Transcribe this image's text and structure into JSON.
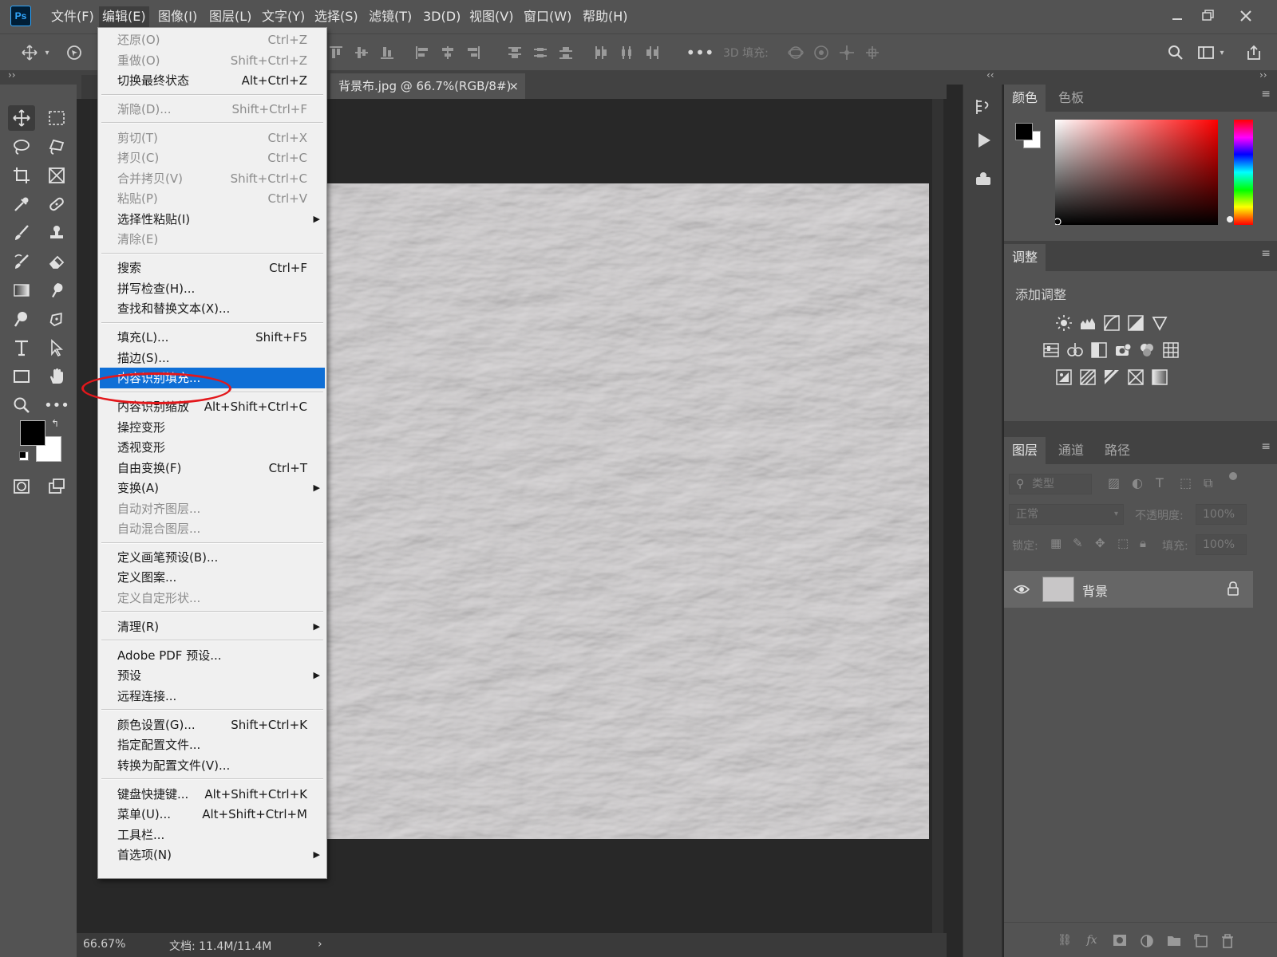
{
  "app": {
    "logo": "Ps"
  },
  "menubar": {
    "items": [
      "文件(F)",
      "编辑(E)",
      "图像(I)",
      "图层(L)",
      "文字(Y)",
      "选择(S)",
      "滤镜(T)",
      "3D(D)",
      "视图(V)",
      "窗口(W)",
      "帮助(H)"
    ],
    "active_index": 1,
    "window_controls": [
      "minimize-icon",
      "restore-icon",
      "close-icon"
    ]
  },
  "options_bar": {
    "fill_label": "3D 填充:",
    "icons": [
      "move-tool-icon",
      "chevron-down-icon",
      "auto-select-icon",
      "align-top-icon",
      "align-vcenter-icon",
      "align-bottom-icon",
      "align-left-icon",
      "align-hcenter-icon",
      "align-right-icon",
      "distribute-top-icon",
      "distribute-vcenter-icon",
      "distribute-bottom-icon",
      "distribute-left-icon",
      "distribute-hcenter-icon",
      "distribute-right-icon",
      "more-icon",
      "3d-orbit-icon",
      "3d-roll-icon",
      "3d-pan-icon",
      "3d-slide-icon",
      "search-icon",
      "workspace-icon",
      "share-icon"
    ]
  },
  "document": {
    "tab_title": "背景布.jpg @ 66.7%(RGB/8#)",
    "tab_close": "×",
    "zoom": "66.67%",
    "doc_info": "文档: 11.4M/11.4M",
    "status_arrow": "›"
  },
  "colors": {
    "foreground": "#000000",
    "background": "#ffffff",
    "highlight": "#0f6fd6",
    "annotation_oval": "#e3171b",
    "panel_bg": "#535353"
  },
  "edit_menu": {
    "items": [
      {
        "label": "还原(O)",
        "shortcut": "Ctrl+Z",
        "disabled": true
      },
      {
        "label": "重做(O)",
        "shortcut": "Shift+Ctrl+Z",
        "disabled": true
      },
      {
        "label": "切换最终状态",
        "shortcut": "Alt+Ctrl+Z",
        "disabled": false
      },
      {
        "sep": true
      },
      {
        "label": "渐隐(D)...",
        "shortcut": "Shift+Ctrl+F",
        "disabled": true
      },
      {
        "sep": true
      },
      {
        "label": "剪切(T)",
        "shortcut": "Ctrl+X",
        "disabled": true
      },
      {
        "label": "拷贝(C)",
        "shortcut": "Ctrl+C",
        "disabled": true
      },
      {
        "label": "合并拷贝(V)",
        "shortcut": "Shift+Ctrl+C",
        "disabled": true
      },
      {
        "label": "粘贴(P)",
        "shortcut": "Ctrl+V",
        "disabled": true
      },
      {
        "label": "选择性粘贴(I)",
        "shortcut": "",
        "disabled": false,
        "submenu": true
      },
      {
        "label": "清除(E)",
        "shortcut": "",
        "disabled": true
      },
      {
        "sep": true
      },
      {
        "label": "搜索",
        "shortcut": "Ctrl+F",
        "disabled": false
      },
      {
        "label": "拼写检查(H)...",
        "shortcut": "",
        "disabled": false
      },
      {
        "label": "查找和替换文本(X)...",
        "shortcut": "",
        "disabled": false
      },
      {
        "sep": true
      },
      {
        "label": "填充(L)...",
        "shortcut": "Shift+F5",
        "disabled": false
      },
      {
        "label": "描边(S)...",
        "shortcut": "",
        "disabled": false
      },
      {
        "label": "内容识别填充...",
        "shortcut": "",
        "disabled": false,
        "highlighted": true
      },
      {
        "sep": true
      },
      {
        "label": "内容识别缩放",
        "shortcut": "Alt+Shift+Ctrl+C",
        "disabled": false
      },
      {
        "label": "操控变形",
        "shortcut": "",
        "disabled": false
      },
      {
        "label": "透视变形",
        "shortcut": "",
        "disabled": false
      },
      {
        "label": "自由变换(F)",
        "shortcut": "Ctrl+T",
        "disabled": false
      },
      {
        "label": "变换(A)",
        "shortcut": "",
        "disabled": false,
        "submenu": true
      },
      {
        "label": "自动对齐图层...",
        "shortcut": "",
        "disabled": true
      },
      {
        "label": "自动混合图层...",
        "shortcut": "",
        "disabled": true
      },
      {
        "sep": true
      },
      {
        "label": "定义画笔预设(B)...",
        "shortcut": "",
        "disabled": false
      },
      {
        "label": "定义图案...",
        "shortcut": "",
        "disabled": false
      },
      {
        "label": "定义自定形状...",
        "shortcut": "",
        "disabled": true
      },
      {
        "sep": true
      },
      {
        "label": "清理(R)",
        "shortcut": "",
        "disabled": false,
        "submenu": true
      },
      {
        "sep": true
      },
      {
        "label": "Adobe PDF 预设...",
        "shortcut": "",
        "disabled": false
      },
      {
        "label": "预设",
        "shortcut": "",
        "disabled": false,
        "submenu": true
      },
      {
        "label": "远程连接...",
        "shortcut": "",
        "disabled": false
      },
      {
        "sep": true
      },
      {
        "label": "颜色设置(G)...",
        "shortcut": "Shift+Ctrl+K",
        "disabled": false
      },
      {
        "label": "指定配置文件...",
        "shortcut": "",
        "disabled": false
      },
      {
        "label": "转换为配置文件(V)...",
        "shortcut": "",
        "disabled": false
      },
      {
        "sep": true
      },
      {
        "label": "键盘快捷键...",
        "shortcut": "Alt+Shift+Ctrl+K",
        "disabled": false
      },
      {
        "label": "菜单(U)...",
        "shortcut": "Alt+Shift+Ctrl+M",
        "disabled": false
      },
      {
        "label": "工具栏...",
        "shortcut": "",
        "disabled": false
      },
      {
        "label": "首选项(N)",
        "shortcut": "",
        "disabled": false,
        "submenu": true
      }
    ]
  },
  "color_panel": {
    "tabs": [
      "颜色",
      "色板"
    ],
    "active_tab": 0
  },
  "adjustments_panel": {
    "tab": "调整",
    "title": "添加调整",
    "icons": [
      "brightness-contrast-icon",
      "levels-icon",
      "curves-icon",
      "exposure-icon",
      "vibrance-icon",
      "hue-saturation-icon",
      "color-balance-icon",
      "black-white-icon",
      "photo-filter-icon",
      "channel-mixer-icon",
      "color-lookup-icon",
      "invert-icon",
      "posterize-icon",
      "threshold-icon",
      "selective-color-icon",
      "gradient-map-icon"
    ]
  },
  "layers_panel": {
    "tabs": [
      "图层",
      "通道",
      "路径"
    ],
    "active_tab": 0,
    "filter_kind": "类型",
    "blend_mode": "正常",
    "opacity_label": "不透明度:",
    "opacity_value": "100%",
    "lock_label": "锁定:",
    "fill_label": "填充:",
    "fill_value": "100%",
    "layers": [
      {
        "name": "背景",
        "visible": true,
        "locked": true
      }
    ],
    "bottom_icons": [
      "link-icon",
      "fx",
      "mask-icon",
      "adjustment-layer-icon",
      "group-folder-icon",
      "new-layer-icon",
      "trash-icon"
    ]
  },
  "toolbar": {
    "tools": [
      "move-tool-icon",
      "marquee-tool-icon",
      "lasso-tool-icon",
      "polygon-lasso-tool-icon",
      "crop-tool-icon",
      "frame-tool-icon",
      "eyedropper-tool-icon",
      "healing-brush-tool-icon",
      "brush-tool-icon",
      "clone-stamp-tool-icon",
      "history-brush-tool-icon",
      "eraser-tool-icon",
      "gradient-tool-icon",
      "smudge-tool-icon",
      "dodge-tool-icon",
      "pen-tool-icon",
      "type-tool-icon",
      "path-select-tool-icon",
      "rectangle-tool-icon",
      "hand-tool-icon",
      "zoom-tool-icon",
      "more-tools-icon",
      "quick-mask-icon",
      "screen-mode-icon"
    ]
  }
}
